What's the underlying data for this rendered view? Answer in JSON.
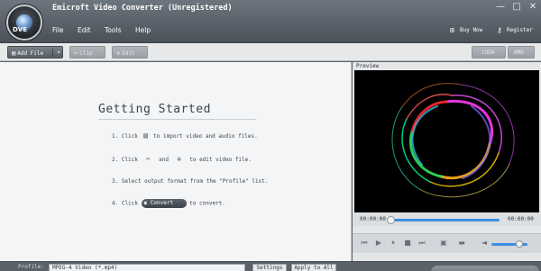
{
  "window": {
    "title": "Emicroft Video Converter (Unregistered)",
    "logo_text": "DVE"
  },
  "window_controls": {
    "minimize": "—",
    "maximize": "□",
    "close": "✕"
  },
  "menu": {
    "items": [
      "File",
      "Edit",
      "Tools",
      "Help"
    ],
    "buy_now": "Buy Now",
    "register": "Register"
  },
  "toolbar": {
    "add_file": "Add File",
    "clip": "Clip",
    "edit": "Edit",
    "cuda": "CUDA",
    "amd": "AMD"
  },
  "getting_started": {
    "title": "Getting Started",
    "step1_a": "1. Click",
    "step1_b": "to import video and audio files.",
    "step2_a": "2. Click",
    "step2_and": "and",
    "step2_b": "to edit video file.",
    "step3": "3. Select output format from the \"Profile\" list.",
    "step4_a": "4. Click",
    "step4_btn": "Convert",
    "step4_b": "to convert."
  },
  "preview": {
    "label": "Preview",
    "time_start": "00:00:00",
    "time_end": "00:00:00",
    "progress": 0.0,
    "volume": 0.8
  },
  "bottom": {
    "profile_label": "Profile:",
    "profile_value": "MPEG-4 Video (*.mp4)",
    "settings": "Settings",
    "apply_all": "Apply to All"
  },
  "colors": {
    "accent_blue": "#3d8fe0",
    "header_dark": "#4a5159",
    "content_bg": "#f4f5f6"
  },
  "icons": [
    "minimize-icon",
    "maximize-icon",
    "close-icon",
    "cart-icon",
    "key-icon",
    "add-file-icon",
    "clip-icon",
    "edit-icon",
    "scissors-icon",
    "convert-icon",
    "rewind-icon",
    "play-icon",
    "pause-icon",
    "stop-icon",
    "forward-icon",
    "snapshot-icon",
    "folder-icon",
    "volume-icon"
  ]
}
